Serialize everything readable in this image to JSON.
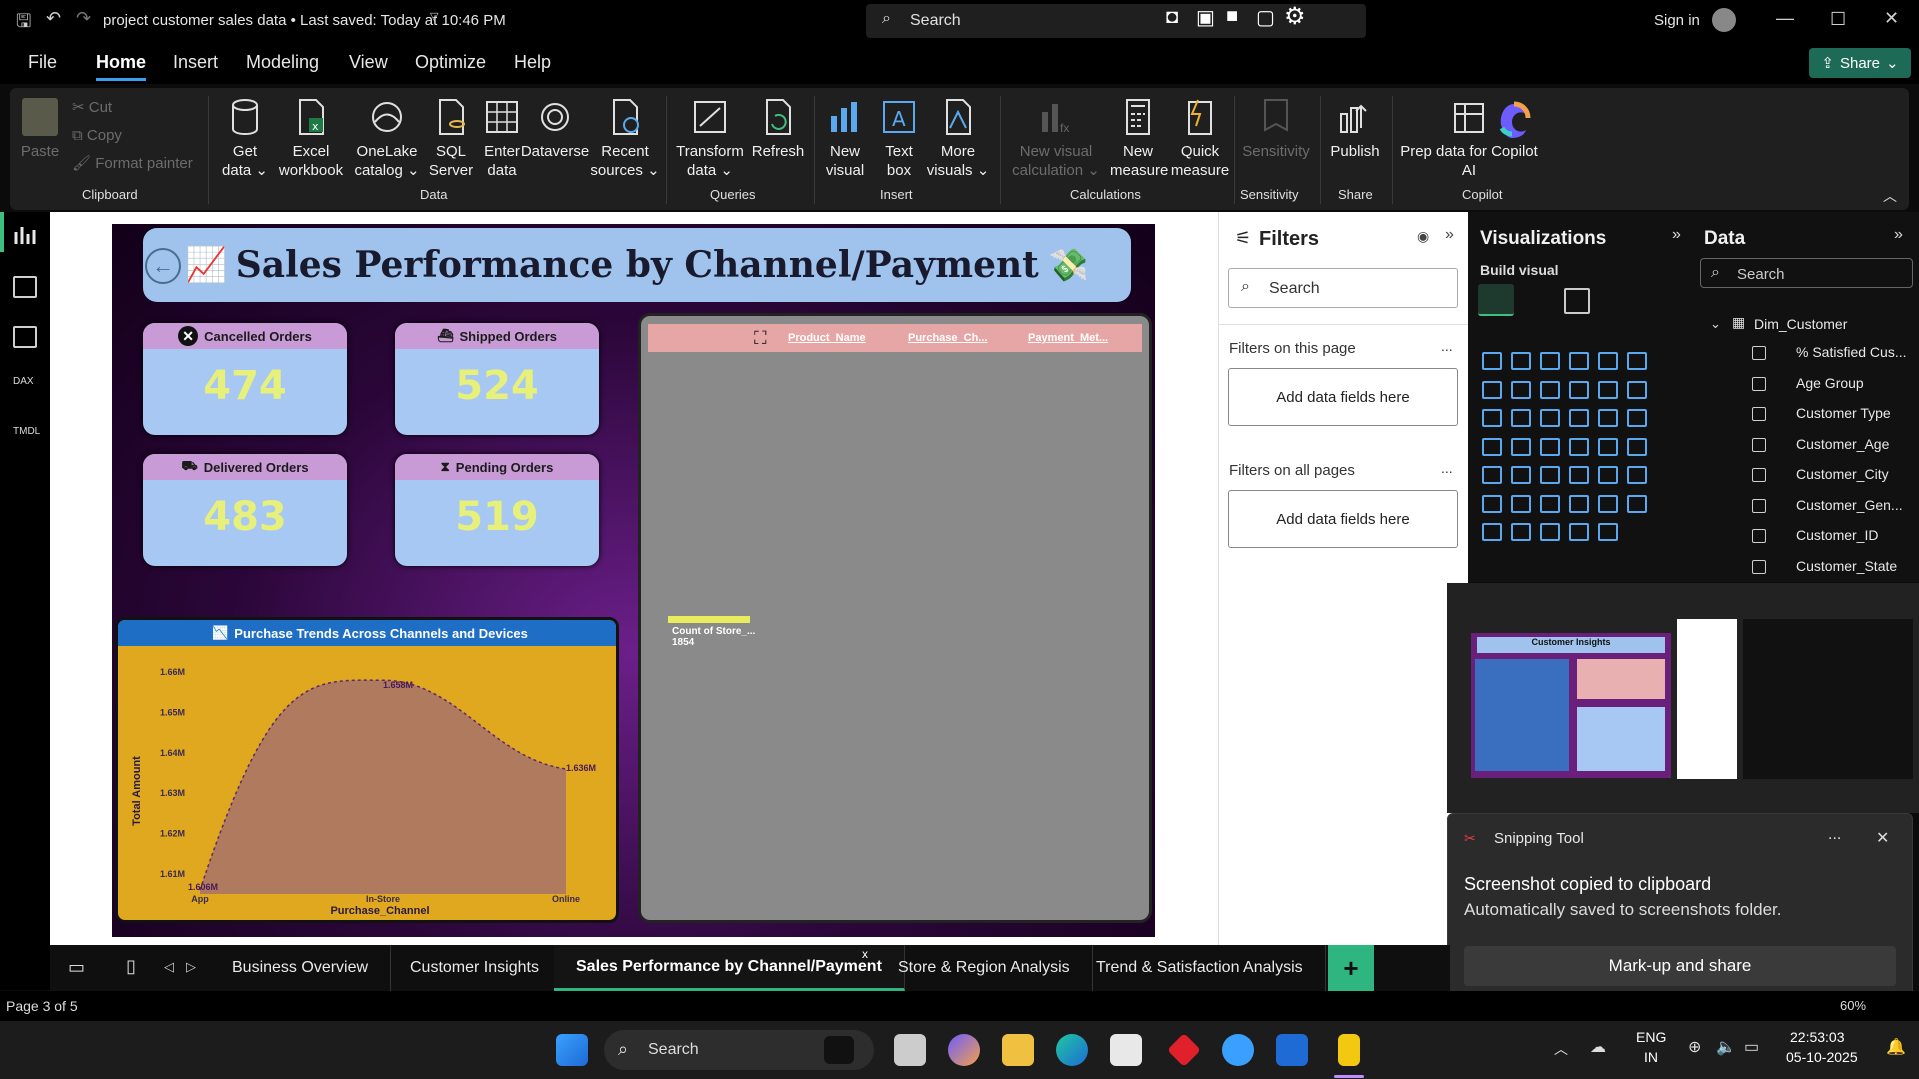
{
  "titlebar": {
    "title": "project customer sales data • Last saved: Today at 10:46 PM",
    "search_label": "Search",
    "sign_in": "Sign in"
  },
  "menu": {
    "items": [
      "File",
      "Home",
      "Insert",
      "Modeling",
      "View",
      "Optimize",
      "Help"
    ],
    "active": "Home",
    "share": "Share"
  },
  "ribbon": {
    "clipboard": {
      "paste": "Paste",
      "cut": "Cut",
      "copy": "Copy",
      "format_painter": "Format painter",
      "group": "Clipboard"
    },
    "data": {
      "get_data": "Get data",
      "excel": "Excel workbook",
      "onelake": "OneLake catalog",
      "sql": "SQL Server",
      "enter": "Enter data",
      "dataverse": "Dataverse",
      "recent": "Recent sources",
      "group": "Data"
    },
    "queries": {
      "transform": "Transform data",
      "refresh": "Refresh",
      "group": "Queries"
    },
    "insert": {
      "new_visual": "New visual",
      "text_box": "Text box",
      "more_visuals": "More visuals",
      "group": "Insert"
    },
    "calculations": {
      "new_visual_calc": "New visual calculation",
      "new_measure": "New measure",
      "quick_measure": "Quick measure",
      "group": "Calculations"
    },
    "sensitivity": {
      "label": "Sensitivity",
      "group": "Sensitivity"
    },
    "share": {
      "publish": "Publish",
      "group": "Share"
    },
    "copilot": {
      "prep": "Prep data for Copilot AI",
      "group": "Copilot"
    }
  },
  "report": {
    "title": "Sales Performance by Channel/Payment",
    "kpis": [
      {
        "label": "Cancelled Orders",
        "value": "474"
      },
      {
        "label": "Shipped Orders",
        "value": "524"
      },
      {
        "label": "Delivered Orders",
        "value": "483"
      },
      {
        "label": "Pending Orders",
        "value": "519"
      }
    ],
    "decomp": {
      "fields": [
        "Product_Name",
        "Purchase_Ch...",
        "Payment_Met..."
      ],
      "measure_label": "Count of Store_...",
      "measure_value": "1854"
    }
  },
  "chart_data": {
    "type": "area",
    "title": "Purchase Trends Across Channels and Devices",
    "xlabel": "Purchase_Channel",
    "ylabel": "Total Amount",
    "categories": [
      "App",
      "In-Store",
      "Online"
    ],
    "values": [
      1.606,
      1.658,
      1.636
    ],
    "data_labels": [
      "1.606M",
      "1.658M",
      "1.636M"
    ],
    "ylim": [
      1.605,
      1.665
    ],
    "yticks": [
      "1.61M",
      "1.62M",
      "1.63M",
      "1.64M",
      "1.65M",
      "1.66M"
    ],
    "ytick_values": [
      1.61,
      1.62,
      1.63,
      1.64,
      1.65,
      1.66
    ],
    "colors": {
      "fill": "#b07a5e",
      "line": "#5a2a6a"
    }
  },
  "filters": {
    "title": "Filters",
    "search": "Search",
    "this_page": "Filters on this page",
    "all_pages": "Filters on all pages",
    "add_fields": "Add data fields here",
    "dots": "..."
  },
  "visualizations": {
    "title": "Visualizations",
    "build": "Build visual"
  },
  "data_pane": {
    "title": "Data",
    "search": "Search",
    "table": "Dim_Customer",
    "fields": [
      "% Satisfied Cus...",
      "Age Group",
      "Customer Type",
      "Customer_Age",
      "Customer_City",
      "Customer_Gen...",
      "Customer_ID",
      "Customer_State"
    ]
  },
  "tabs": {
    "items": [
      "Business Overview",
      "Customer Insights",
      "Sales Performance by Channel/Payment",
      "Store & Region Analysis",
      "Trend & Satisfaction Analysis"
    ],
    "active": "Sales Performance by Channel/Payment",
    "close": "x",
    "add": "+"
  },
  "status": {
    "page": "Page 3 of 5",
    "zoom": "60%"
  },
  "snipping": {
    "app": "Snipping Tool",
    "title": "Screenshot copied to clipboard",
    "subtitle": "Automatically saved to screenshots folder.",
    "action": "Mark-up and share",
    "dots": "...",
    "close": "✕",
    "preview_title": "Customer Insights"
  },
  "taskbar": {
    "search": "Search",
    "lang": "ENG",
    "region": "IN",
    "time": "22:53:03",
    "date": "05-10-2025"
  }
}
